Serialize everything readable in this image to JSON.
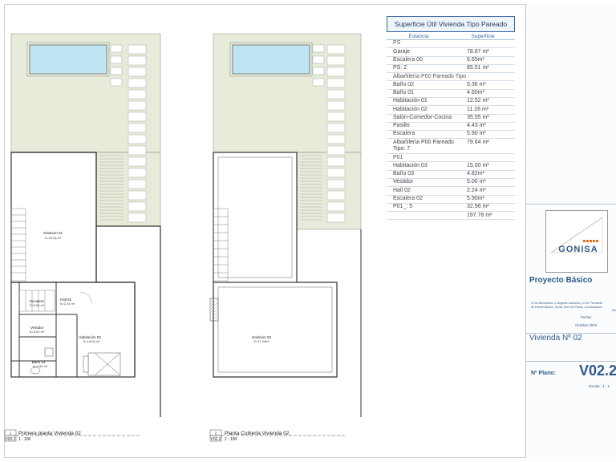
{
  "table": {
    "title": "Superficie Útil Vivienda Tipo Pareado",
    "col_estancia": "Estancia",
    "col_superficie": "Superficie",
    "rows": [
      {
        "n": "PS",
        "v": ""
      },
      {
        "n": "Garaje",
        "v": "78.87 m²"
      },
      {
        "n": "Escalera 00",
        "v": "6.65m²"
      },
      {
        "n": "PS: 2",
        "v": "85.51 m²"
      },
      {
        "n": "Albañilería P00 Pareado Tipo",
        "v": ""
      },
      {
        "n": "Baño 02",
        "v": "5.36 m²"
      },
      {
        "n": "Baño 01",
        "v": "4.60m²"
      },
      {
        "n": "Habitación 01",
        "v": "12.52 m²"
      },
      {
        "n": "Habitación 02",
        "v": "11.28 m²"
      },
      {
        "n": "Salón-Comedor-Cocina",
        "v": "35.55 m²"
      },
      {
        "n": "Pasillo",
        "v": "4.43 m²"
      },
      {
        "n": "Escalera",
        "v": "5.90 m²"
      },
      {
        "n": "Albañilería P00 Pareado Tipo: 7",
        "v": "79.64 m²"
      },
      {
        "n": "P01",
        "v": ""
      },
      {
        "n": "Habitación 03",
        "v": "15.00 m²"
      },
      {
        "n": "Baño 03",
        "v": "4.82m²"
      },
      {
        "n": "Vestidor",
        "v": "5.00 m²"
      },
      {
        "n": "Hall 02",
        "v": "2.24 m²"
      },
      {
        "n": "Escalera 02",
        "v": "5.90m²"
      },
      {
        "n": "P01_: 5",
        "v": "32.96 m²"
      },
      {
        "n": "",
        "v": "197.78 m²"
      }
    ]
  },
  "plan1": {
    "rooms": {
      "solarium": "Solarium 01",
      "solarium_area": "S=49.9§ m²",
      "escalera": "Escalera",
      "escalera_area": "S=5.90 m²",
      "hall": "Hall 02",
      "hall_area": "S=2.24 m²",
      "vestidor": "Vestidor",
      "vestidor_area": "S=5.00 m²",
      "habitacion": "Habitación 03",
      "habitacion_area": "S=15.0§ m²",
      "bano": "Baño 03",
      "bano_area": "S=4.82 m²"
    },
    "caption_num": "1",
    "caption_title": "Primera planta Vivienda 02",
    "caption_ref": "V02.2",
    "caption_scale": "1 : 100"
  },
  "plan2": {
    "rooms": {
      "solarium": "Solarium 02",
      "solarium_area": "S=37.29m²"
    },
    "caption_num": "2",
    "caption_title": "Planta Cubierta Vivienda 02",
    "caption_ref": "V02.2",
    "caption_scale": "1 : 100"
  },
  "titleblock": {
    "logo_text": "GONISA",
    "project": "Proyecto Básico",
    "address_1": "C/ los Benedictos, c/ Ángeles Lamberto y c/ Dr. Fernando",
    "address_2": "de Puente Blanco, Sector Torre del Rame, Los Alcázares",
    "address_3": "Mu",
    "fecha_label": "Fecha:",
    "fecha_value": "Octubre 2024",
    "vivienda": "Vivienda Nº 02",
    "plano_label": "Nº Plano:",
    "plano_value": "V02.2",
    "escala": "Escala : 1 : 1"
  },
  "colors": {
    "garden": "#e6ecd9",
    "pool": "#bfe4f2",
    "accent": "#2e5a8a"
  }
}
